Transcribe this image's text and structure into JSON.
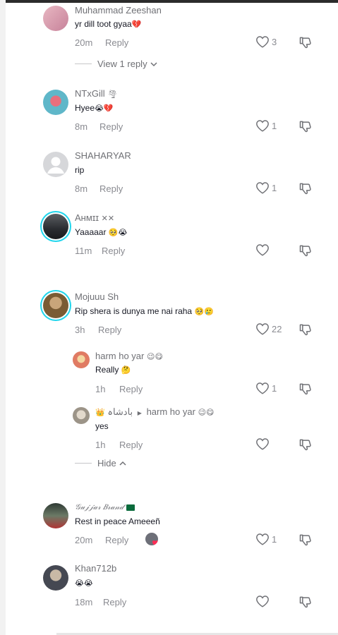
{
  "comments": [
    {
      "name": "Muhammad Zeeshan",
      "text": "yr dill toot gyaa",
      "text_emoji": "💔",
      "time": "20m",
      "reply": "Reply",
      "likes": "3",
      "avatar_color": "#d7a1b0"
    },
    {
      "view_replies": "View 1 reply"
    },
    {
      "name": "NTxGill",
      "name_emoji": "🌪",
      "text": "Hyee",
      "text_emoji": "😭💔",
      "time": "8m",
      "reply": "Reply",
      "likes": "1",
      "avatar_color": "#5fb7c9"
    },
    {
      "name": "SHAHARYAR",
      "text": "rip",
      "time": "8m",
      "reply": "Reply",
      "likes": "1",
      "avatar_color": "#cfd0d3"
    },
    {
      "name": "Aʜᴍɪɪ",
      "name_emoji": "✕✕",
      "text": "Yaaaaar",
      "text_emoji": "🥺😭",
      "time": "11m",
      "reply": "Reply",
      "likes": "",
      "avatar_color": "#3a3d42"
    },
    {
      "name": "Mojuuu Sh",
      "text": "Rip shera is dunya me nai raha",
      "text_emoji": "🥺🥲",
      "time": "3h",
      "reply": "Reply",
      "likes": "22",
      "avatar_color": "#8a6a3f"
    },
    {
      "name": "harm ho yar",
      "name_emoji": "😉😋",
      "text": "Really",
      "text_emoji": "🤔",
      "time": "1h",
      "reply": "Reply",
      "likes": "1",
      "avatar_color": "#e07b63"
    },
    {
      "name_prefix": "👑 بادشاہ",
      "name_arrow": "▶",
      "name": "harm ho yar",
      "name_emoji": "😉😋",
      "text": "yes",
      "time": "1h",
      "reply": "Reply",
      "likes": "",
      "avatar_color": "#b9b2a6"
    },
    {
      "hide": "Hide"
    },
    {
      "name": "𝒢𝓊𝒿𝒿𝒶𝓇 𝐵𝓇𝒶𝓃𝒹",
      "text": "Rest in peace Ameeeñ",
      "time": "20m",
      "reply": "Reply",
      "likes": "1",
      "avatar_color": "#4c5a4a"
    },
    {
      "name": "Khan712b",
      "text_emoji": "😭😭",
      "time": "18m",
      "reply": "Reply",
      "likes": "",
      "avatar_color": "#5b5f68"
    }
  ],
  "colors": {
    "ring": "#20d5ec",
    "muted": "#8a8b91",
    "text": "#161823"
  },
  "icons": {
    "like": "heart-outline-icon",
    "dislike": "thumbs-down-icon",
    "chevron": "chevron-icon"
  }
}
